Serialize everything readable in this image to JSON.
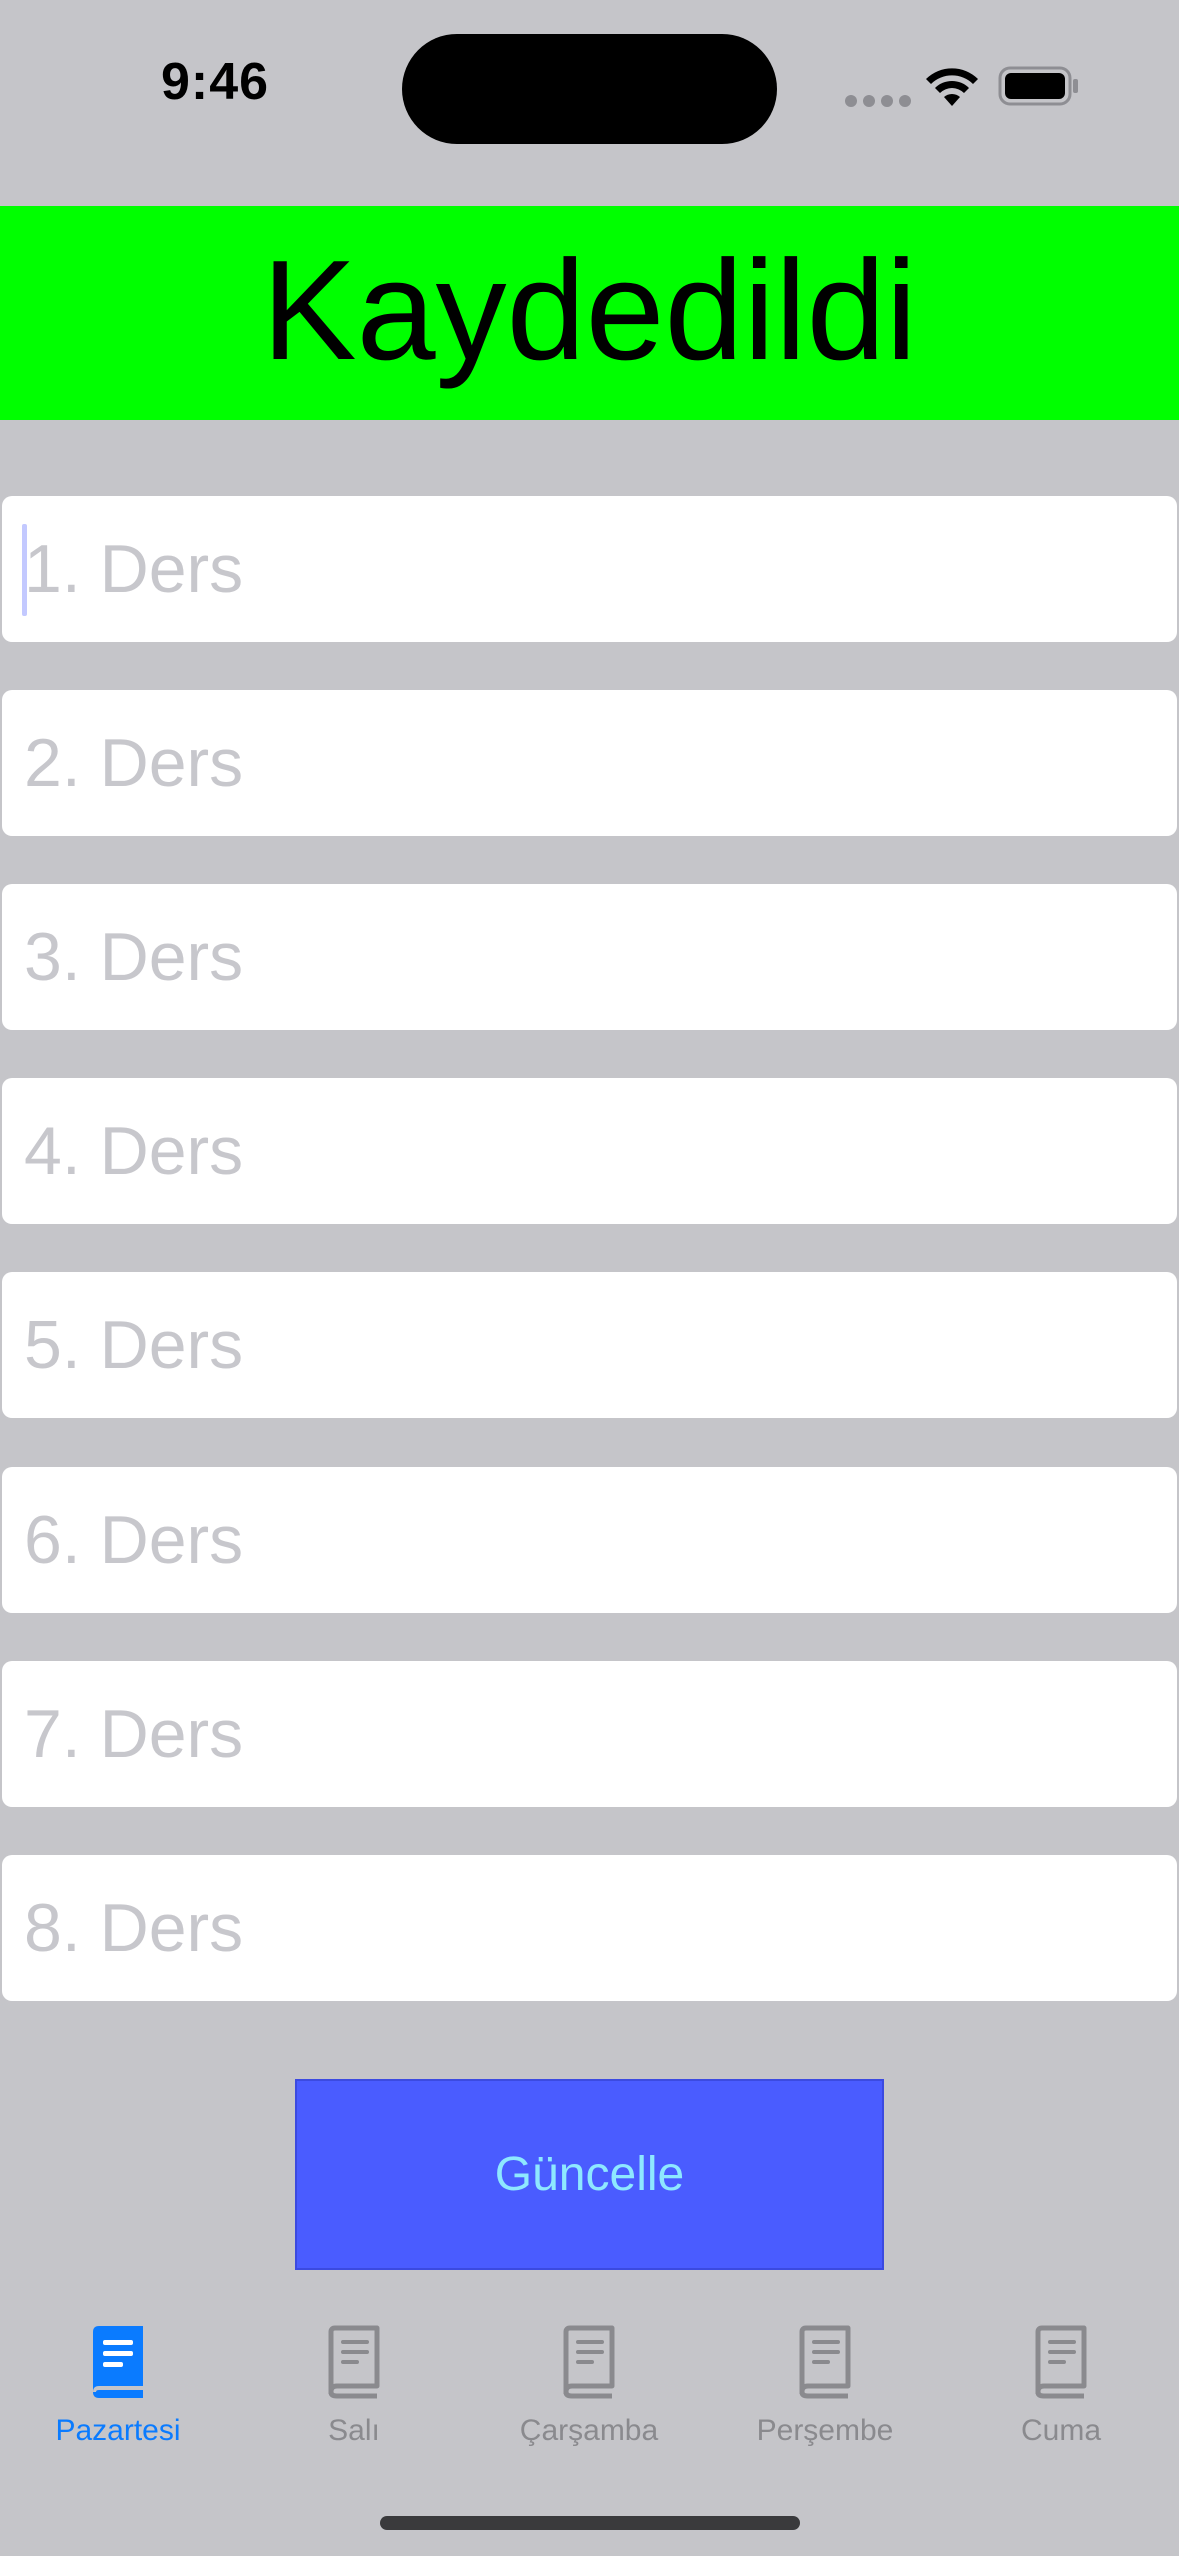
{
  "status_bar": {
    "time": "9:46"
  },
  "banner": {
    "text": "Kaydedildi",
    "color": "#00ff00"
  },
  "fields": [
    {
      "placeholder": "1. Ders",
      "value": ""
    },
    {
      "placeholder": "2. Ders",
      "value": ""
    },
    {
      "placeholder": "3. Ders",
      "value": ""
    },
    {
      "placeholder": "4. Ders",
      "value": ""
    },
    {
      "placeholder": "5. Ders",
      "value": ""
    },
    {
      "placeholder": "6. Ders",
      "value": ""
    },
    {
      "placeholder": "7. Ders",
      "value": ""
    },
    {
      "placeholder": "8. Ders",
      "value": ""
    }
  ],
  "update_button": {
    "label": "Güncelle",
    "color": "#4a5cff"
  },
  "tabs": [
    {
      "label": "Pazartesi",
      "icon": "book-icon",
      "active": true
    },
    {
      "label": "Salı",
      "icon": "book-icon",
      "active": false
    },
    {
      "label": "Çarşamba",
      "icon": "book-icon",
      "active": false
    },
    {
      "label": "Perşembe",
      "icon": "book-icon",
      "active": false
    },
    {
      "label": "Cuma",
      "icon": "book-icon",
      "active": false
    }
  ],
  "colors": {
    "background": "#c5c5c9",
    "active_tab": "#0a7bff",
    "inactive_tab": "#8a8a8e"
  }
}
